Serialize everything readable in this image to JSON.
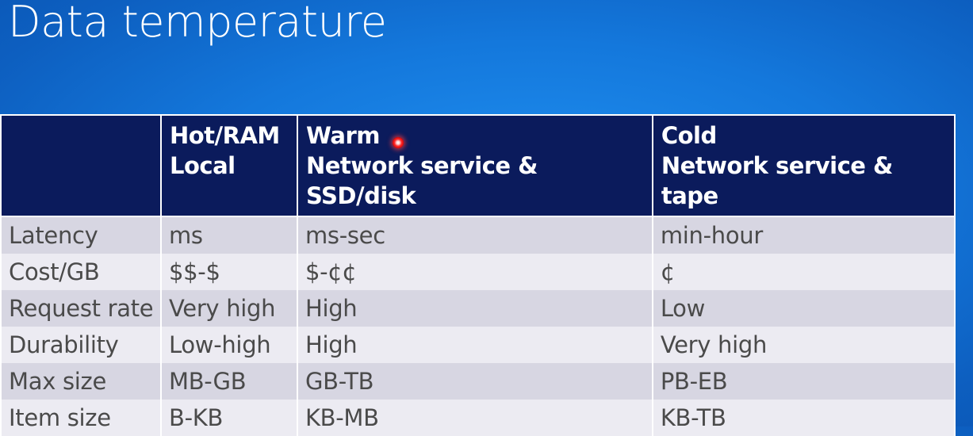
{
  "slide": {
    "title": "Data temperature"
  },
  "table": {
    "headers": [
      {
        "line1": "",
        "line2": ""
      },
      {
        "line1": "Hot/RAM",
        "line2": "Local"
      },
      {
        "line1": "Warm",
        "line2": "Network service & SSD/disk"
      },
      {
        "line1": "Cold",
        "line2": "Network service & tape"
      }
    ],
    "rows": [
      [
        "Latency",
        "ms",
        "ms-sec",
        "min-hour"
      ],
      [
        "Cost/GB",
        "$$-$",
        "$-¢¢",
        "¢"
      ],
      [
        "Request rate",
        "Very high",
        "High",
        "Low"
      ],
      [
        "Durability",
        "Low-high",
        "High",
        "Very high"
      ],
      [
        "Max size",
        "MB-GB",
        "GB-TB",
        "PB-EB"
      ],
      [
        "Item size",
        "B-KB",
        "KB-MB",
        "KB-TB"
      ]
    ]
  },
  "colors": {
    "background": "#1478dc",
    "header_fill": "#0b1b5c",
    "row_odd": "#d7d6e2",
    "row_even": "#ecebf2",
    "pointer": "#ff2a2a"
  }
}
